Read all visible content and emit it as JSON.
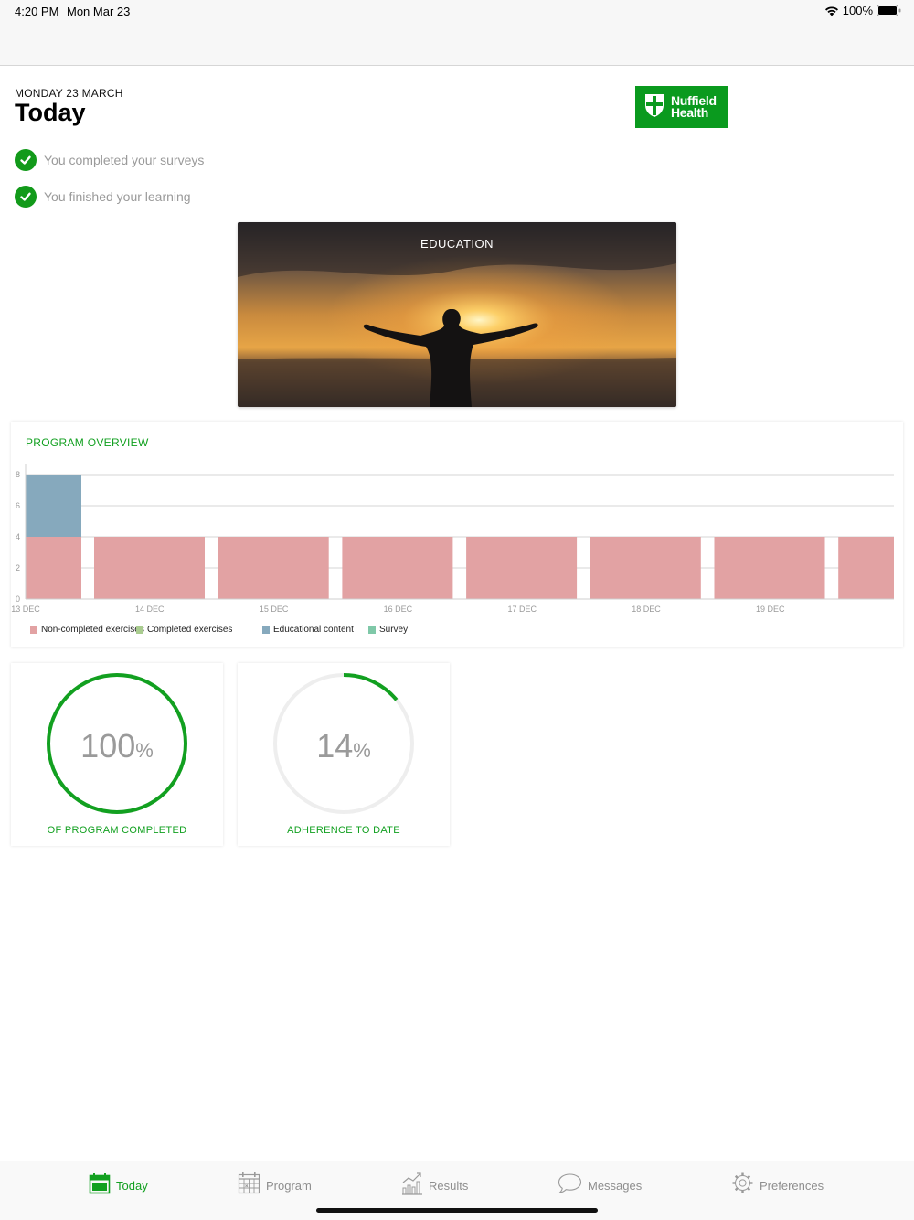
{
  "status_bar": {
    "time": "4:20 PM",
    "date": "Mon Mar 23",
    "battery": "100%"
  },
  "header": {
    "dateline": "MONDAY 23 MARCH",
    "title": "Today",
    "logo_line1": "Nuffield",
    "logo_line2": "Health"
  },
  "completed": [
    {
      "text": "You completed your surveys"
    },
    {
      "text": "You finished your learning"
    }
  ],
  "education_card": {
    "label": "EDUCATION"
  },
  "overview": {
    "title": "PROGRAM OVERVIEW",
    "legend": [
      {
        "label": "Non-completed exercises",
        "color": "#e2a2a3"
      },
      {
        "label": "Completed exercises",
        "color": "#a9cc8f"
      },
      {
        "label": "Educational content",
        "color": "#86a9bd"
      },
      {
        "label": "Survey",
        "color": "#7fc8a8"
      }
    ]
  },
  "chart_data": {
    "type": "bar",
    "x_tick_labels": [
      "13 DEC",
      "14 DEC",
      "15 DEC",
      "16 DEC",
      "17 DEC",
      "18 DEC",
      "19 DEC"
    ],
    "y_ticks": [
      0,
      2,
      4,
      6,
      8
    ],
    "ylim": [
      0,
      8
    ],
    "series": [
      {
        "name": "Non-completed exercises",
        "color": "#e2a2a3",
        "values": [
          4,
          4,
          4,
          4,
          4,
          4,
          4,
          4
        ]
      },
      {
        "name": "Educational content",
        "color": "#86a9bd",
        "values": [
          4,
          0,
          0,
          0,
          0,
          0,
          0,
          0
        ]
      }
    ],
    "grid": true,
    "legend_position": "bottom-left"
  },
  "stats": [
    {
      "value": "100",
      "unit": "%",
      "fraction": 1.0,
      "label": "OF PROGRAM COMPLETED"
    },
    {
      "value": "14",
      "unit": "%",
      "fraction": 0.14,
      "label": "ADHERENCE TO DATE"
    }
  ],
  "tabs": [
    {
      "label": "Today",
      "icon": "calendar-today-icon",
      "active": true
    },
    {
      "label": "Program",
      "icon": "calendar-grid-icon",
      "active": false
    },
    {
      "label": "Results",
      "icon": "chart-icon",
      "active": false
    },
    {
      "label": "Messages",
      "icon": "speech-bubble-icon",
      "active": false
    },
    {
      "label": "Preferences",
      "icon": "gear-icon",
      "active": false
    }
  ],
  "colors": {
    "accent": "#12a020",
    "brand": "#0a9a1e"
  }
}
